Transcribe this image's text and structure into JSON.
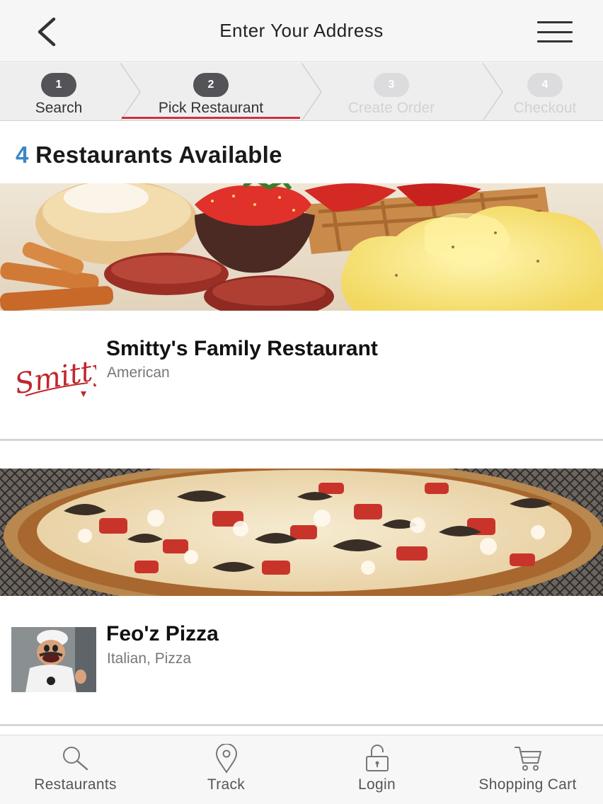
{
  "header": {
    "title": "Enter Your Address",
    "back_icon": "chevron-left-icon",
    "menu_icon": "hamburger-menu-icon"
  },
  "steps": [
    {
      "number": "1",
      "label": "Search",
      "state": "complete"
    },
    {
      "number": "2",
      "label": "Pick Restaurant",
      "state": "active"
    },
    {
      "number": "3",
      "label": "Create Order",
      "state": "disabled"
    },
    {
      "number": "4",
      "label": "Checkout",
      "state": "disabled"
    }
  ],
  "results": {
    "count": "4",
    "label": "Restaurants Available"
  },
  "restaurants": [
    {
      "name": "Smitty's Family Restaurant",
      "cuisine": "American",
      "logo_text": "Smitty's",
      "photo": "breakfast-plate-photo"
    },
    {
      "name": "Feo'z Pizza",
      "cuisine": "Italian, Pizza",
      "photo": "pizza-photo",
      "logo": "chef-puppet-photo"
    }
  ],
  "bottom_nav": [
    {
      "label": "Restaurants",
      "icon": "search-icon"
    },
    {
      "label": "Track",
      "icon": "map-pin-icon"
    },
    {
      "label": "Login",
      "icon": "lock-icon"
    },
    {
      "label": "Shopping Cart",
      "icon": "cart-icon"
    }
  ],
  "colors": {
    "accent": "#d32f3c",
    "count_blue": "#3d86c6",
    "step_done": "#545458",
    "step_todo": "#dcdcdf"
  }
}
